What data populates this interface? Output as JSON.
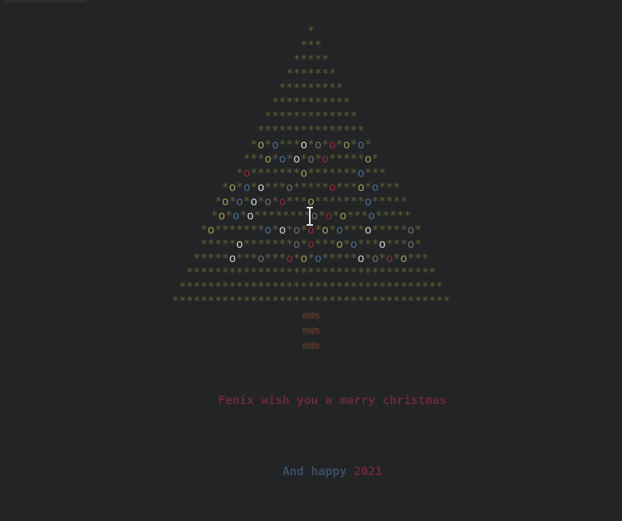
{
  "colors": {
    "background": "#222426",
    "star": "#5e5f35",
    "trunk": "#6b3f2a",
    "ornament_blue": "#4a6a8c",
    "ornament_red": "#8c2a3a",
    "ornament_white": "#c8c8c8",
    "ornament_olive": "#9a9a52",
    "ornament_gray": "#6a6a6a",
    "message_red": "#6a2a35",
    "message_blue": "#3a4d66"
  },
  "tree": {
    "rows": [
      "*",
      "***",
      "*****",
      "*******",
      "*********",
      "***********",
      "*************",
      "***************",
      "*o*o***o*o*o*o*o*",
      "***o*o*o*o*o*****o*",
      "*o*******o*******o***",
      "*o*o*o***o*****o***o*o***",
      "*o*o*o*o*o***o*******o*****",
      "*o*o*o********o*o*o***o*****",
      "*o*******o*o*o*o*o*o***o*****o*",
      "*****o*******o*o***o*o***o***o*",
      "*****o***o***o*o*o*****o*o*o*o***",
      "***********************************",
      "*************************************",
      "***************************************"
    ],
    "trunk": [
      "mWm",
      "mWm",
      "mWm"
    ]
  },
  "message": {
    "line1": "Fenix wish you a merry christmas",
    "line2_part1": "And happy ",
    "line2_part2": "2021"
  }
}
